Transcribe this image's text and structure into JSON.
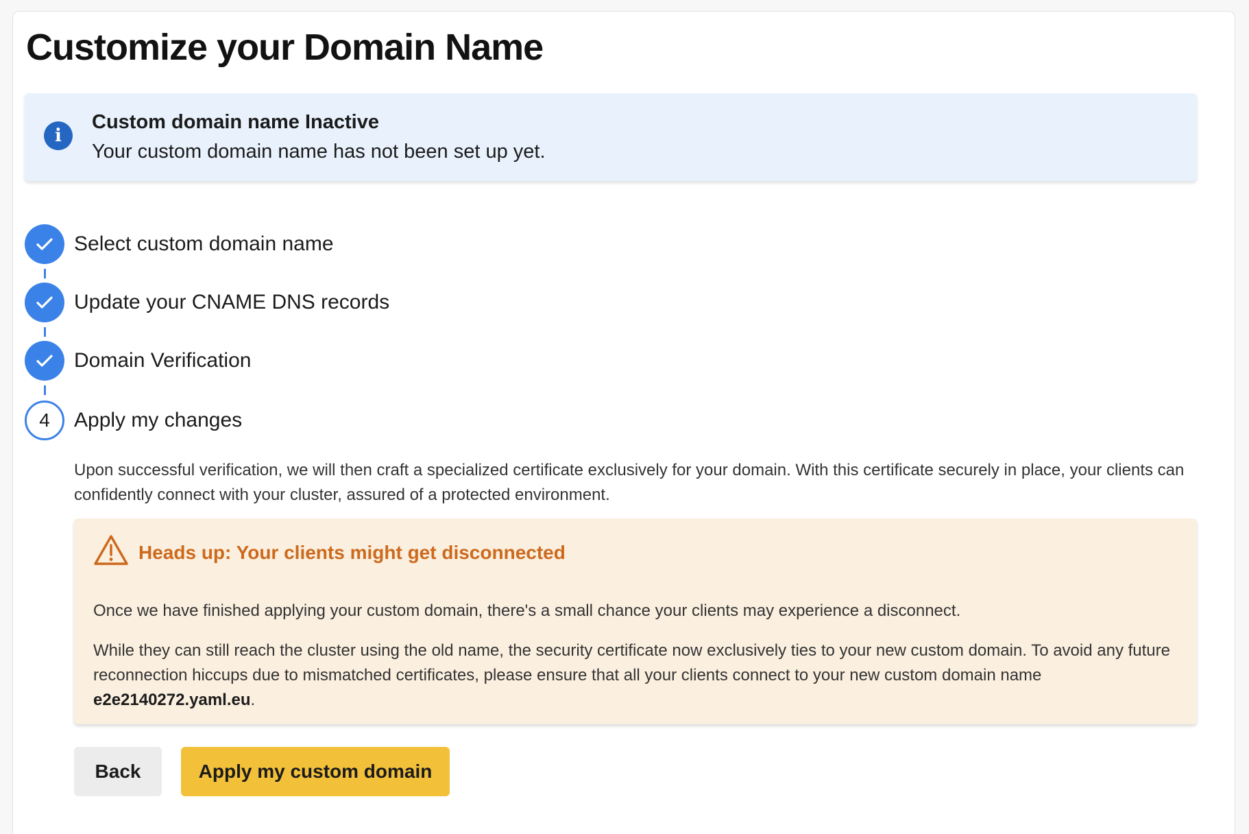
{
  "page": {
    "title": "Customize your Domain Name"
  },
  "info_alert": {
    "icon": "info-icon",
    "title": "Custom domain name Inactive",
    "message": "Your custom domain name has not been set up yet."
  },
  "steps": [
    {
      "label": "Select custom domain name",
      "status": "completed",
      "icon": "check-icon"
    },
    {
      "label": "Update your CNAME DNS records",
      "status": "completed",
      "icon": "check-icon"
    },
    {
      "label": "Domain Verification",
      "status": "completed",
      "icon": "check-icon"
    },
    {
      "label": "Apply my changes",
      "status": "current",
      "number": "4"
    }
  ],
  "current_step": {
    "description": "Upon successful verification, we will then craft a specialized certificate exclusively for your domain. With this certificate securely in place, your clients can confidently connect with your cluster, assured of a protected environment."
  },
  "warning": {
    "icon": "warning-triangle-icon",
    "title": "Heads up: Your clients might get disconnected",
    "paragraph1": "Once we have finished applying your custom domain, there's a small chance your clients may experience a disconnect.",
    "paragraph2": "While they can still reach the cluster using the old name, the security certificate now exclusively ties to your new custom domain. To avoid any future reconnection hiccups due to mismatched certificates, please ensure that all your clients connect to your new custom domain name",
    "domain": "e2e2140272.yaml.eu",
    "end_punctuation": "."
  },
  "actions": {
    "back_label": "Back",
    "apply_label": "Apply my custom domain"
  },
  "colors": {
    "info_bg": "#e8f1fc",
    "info_icon": "#2466c2",
    "step_accent": "#3b82e8",
    "warning_bg": "#fbefdf",
    "warning_text": "#cc6a1d",
    "primary_button": "#f3c03a",
    "secondary_button": "#ececec"
  }
}
